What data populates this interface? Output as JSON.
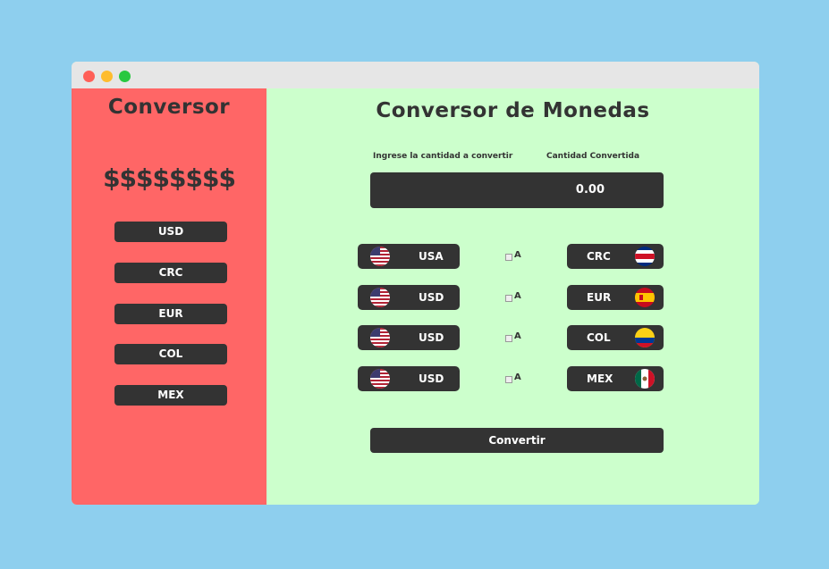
{
  "window": {
    "controls": [
      "close",
      "minimize",
      "maximize"
    ]
  },
  "sidebar": {
    "title": "Conversor",
    "money": "$$$$$$$$",
    "buttons": [
      "USD",
      "CRC",
      "EUR",
      "COL",
      "MEX"
    ]
  },
  "main": {
    "title": "Conversor de Monedas",
    "input_label": "Ingrese la cantidad a convertir",
    "output_label": "Cantidad Convertida",
    "amount": "0.00",
    "rows": [
      {
        "from": "USA",
        "from_flag": "us-flag-icon",
        "swap": "A",
        "to": "CRC",
        "to_flag": "costa-rica-flag-icon"
      },
      {
        "from": "USD",
        "from_flag": "us-flag-icon",
        "swap": "A",
        "to": "EUR",
        "to_flag": "spain-flag-icon"
      },
      {
        "from": "USD",
        "from_flag": "us-flag-icon",
        "swap": "A",
        "to": "COL",
        "to_flag": "colombia-flag-icon"
      },
      {
        "from": "USD",
        "from_flag": "us-flag-icon",
        "swap": "A",
        "to": "MEX",
        "to_flag": "mexico-flag-icon"
      }
    ],
    "convert_label": "Convertir"
  },
  "colors": {
    "page_bg": "#8ecfee",
    "sidebar_bg": "#ff6666",
    "main_bg": "#ccffcc",
    "button_bg": "#333333",
    "text": "#333333"
  }
}
